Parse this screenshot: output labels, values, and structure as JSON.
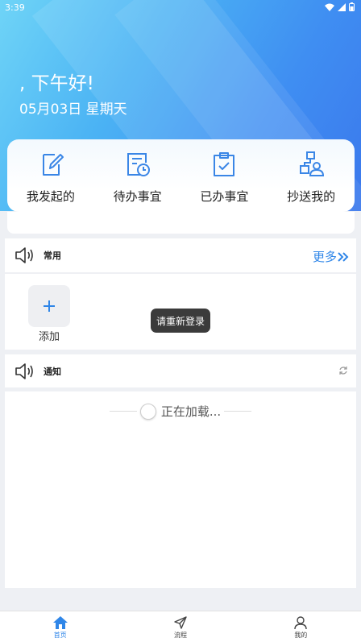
{
  "status_bar": {
    "time": "3:39"
  },
  "header": {
    "greeting": ", 下午好!",
    "date": "05月03日 星期天"
  },
  "colors": {
    "accent": "#2f86e8",
    "hero_start": "#6fd4f7",
    "hero_end": "#3b78ec",
    "icon_blue": "#3a86e6"
  },
  "quick_actions": [
    {
      "label": "我发起的",
      "icon": "edit-document-icon"
    },
    {
      "label": "待办事宜",
      "icon": "pending-clock-icon"
    },
    {
      "label": "已办事宜",
      "icon": "clipboard-check-icon"
    },
    {
      "label": "抄送我的",
      "icon": "org-user-icon"
    }
  ],
  "common": {
    "title": "常用",
    "more": "更多",
    "add_label": "添加"
  },
  "toast": "请重新登录",
  "notice": {
    "title": "通知",
    "loading": "正在加载..."
  },
  "tabs": [
    {
      "label": "首页",
      "icon": "home-icon",
      "active": true
    },
    {
      "label": "流程",
      "icon": "send-icon",
      "active": false
    },
    {
      "label": "我的",
      "icon": "person-icon",
      "active": false
    }
  ]
}
